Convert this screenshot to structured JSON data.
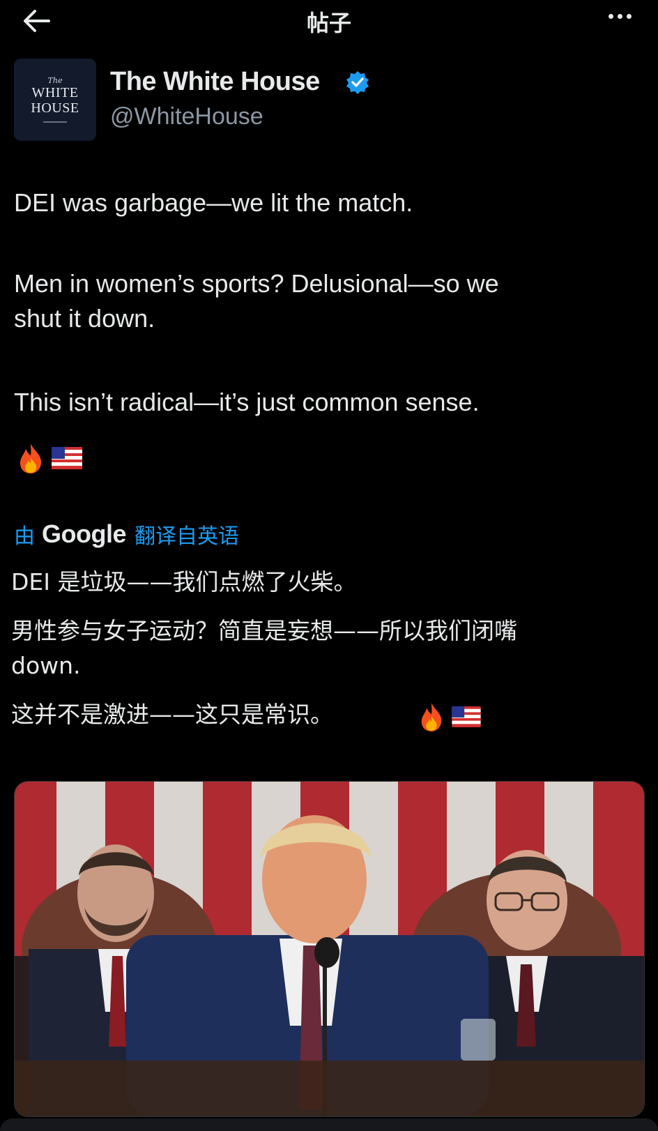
{
  "topbar": {
    "title": "帖子",
    "back_icon": "arrow-left-icon",
    "more_icon": "more-dots-icon"
  },
  "account": {
    "avatar_lines": [
      "The",
      "WHITE",
      "HOUSE"
    ],
    "name": "The White House",
    "handle": "@WhiteHouse",
    "verified_color": "#1d9bf0"
  },
  "tweet": {
    "line1": "DEI was garbage—we lit the match.",
    "line2a": "Men in women’s sports? Delusional—so we",
    "line2b": "shut it down.",
    "line3": "This isn’t radical—it’s just common sense.",
    "emojis": [
      "fire-emoji",
      "us-flag-emoji"
    ]
  },
  "translation": {
    "prefix": "由",
    "provider": "Google",
    "suffix": "翻译自英语",
    "line1": "DEI 是垃圾——我们点燃了火柴。",
    "line2": "男性参与女子运动？简直是妄想——所以我们闭嘴",
    "line3": "down.",
    "line4": "这并不是激进——这只是常识。"
  },
  "colors": {
    "background": "#000000",
    "text": "#e7e9ea",
    "secondary": "#8b98a5",
    "accent": "#1d9bf0"
  }
}
